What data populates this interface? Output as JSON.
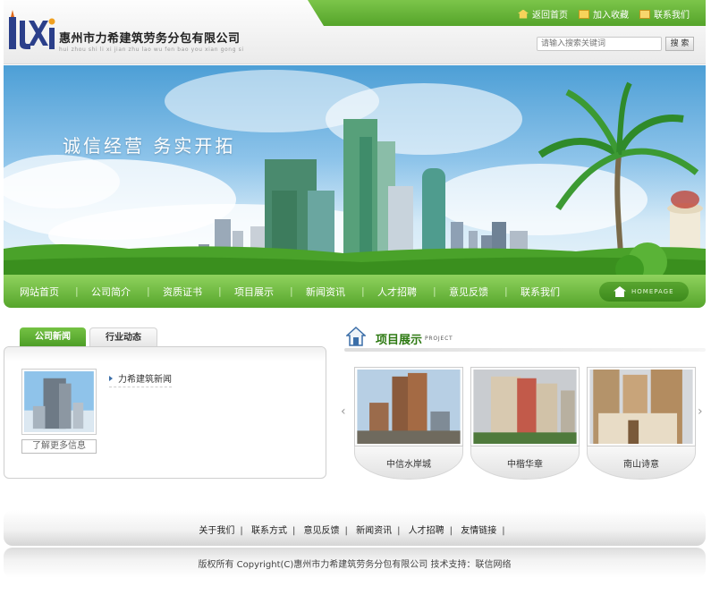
{
  "header": {
    "company_name": "惠州市力希建筑劳务分包有限公司",
    "company_pinyin": "hui zhou shi li xi jian zhu lao wu fen bao you xian gong si",
    "top_links": [
      {
        "label": "返回首页",
        "icon": "home-icon"
      },
      {
        "label": "加入收藏",
        "icon": "favorite-icon"
      },
      {
        "label": "联系我们",
        "icon": "mail-icon"
      }
    ],
    "search_placeholder": "请输入搜索关键词",
    "search_button": "搜 索"
  },
  "banner": {
    "slogan": "诚信经营  务实开拓"
  },
  "nav": {
    "items": [
      "网站首页",
      "公司简介",
      "资质证书",
      "项目展示",
      "新闻资讯",
      "人才招聘",
      "意见反馈",
      "联系我们"
    ],
    "homepage_label": "HOMEPAGE"
  },
  "news": {
    "tabs": [
      "公司新闻",
      "行业动态"
    ],
    "items": [
      "力希建筑新闻"
    ],
    "more_label": "了解更多信息"
  },
  "projects": {
    "title": "项目展示",
    "title_en": "PROJECT",
    "cards": [
      "中信水岸城",
      "中楷华章",
      "南山诗意"
    ]
  },
  "footer": {
    "links": [
      "关于我们",
      "联系方式",
      "意见反馈",
      "新闻资讯",
      "人才招聘",
      "友情链接"
    ],
    "copyright": "版权所有 Copyright(C)惠州市力希建筑劳务分包有限公司  技术支持：联信网络"
  },
  "colors": {
    "nav_green": "#56a52c",
    "title_green": "#2e7a13",
    "link_blue": "#3b6ea8"
  }
}
